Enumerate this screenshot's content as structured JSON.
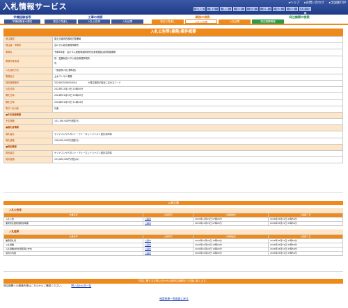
{
  "header": {
    "brand": "入札情報サービス",
    "links": [
      {
        "icon": "help-icon",
        "label": "ヘルプ"
      },
      {
        "icon": "mail-icon",
        "label": "お問い合わせ"
      },
      {
        "icon": "home-icon",
        "label": "全国版TOP"
      }
    ],
    "regions": [
      "北海道",
      "東北",
      "関東",
      "北陸",
      "中部",
      "近畿",
      "中国",
      "四国",
      "九州・沖縄"
    ]
  },
  "nav": {
    "groups": [
      {
        "title": "学識経験者等",
        "style": "blue",
        "tabs": [
          "学識経験者の選任"
        ]
      },
      {
        "title": "工事の検索",
        "style": "blue",
        "tabs": [
          "発注の見通し",
          "入札公告等",
          "入札結果"
        ]
      },
      {
        "title": "業務の検索",
        "style": "orange",
        "tabs": [
          "発注の見通し",
          "入札公告等",
          "入札結果"
        ],
        "selected": 1
      },
      {
        "title": "発注機関の検索",
        "style": "green",
        "tabs": [
          "発注機関情報"
        ]
      }
    ]
  },
  "page_title": "入札公告等(業務)案件概要",
  "info_rows": [
    {
      "key": "発注機関",
      "value": "国土交通省四国地方整備局"
    },
    {
      "key": "発注者・事務所",
      "value": "吉川ダム総合管理事務所"
    },
    {
      "key": "業務名",
      "value": "令和6年度　吉川ダム統管電源関係外自家発施設点検修繕業務"
    },
    {
      "key": "業務対象地域",
      "value": "県：愛媛県吉川ダム総合管理事務所",
      "value2": "市",
      "tall": true
    },
    {
      "key": "入札契約方式",
      "value": "一般競争入札(標準型)"
    },
    {
      "key": "業務区分",
      "value": "土木コンサル業務"
    },
    {
      "key": "契約管理番号",
      "value": "2024007006020004",
      "note": "※発注機関が独自に定めるコード"
    },
    {
      "key": "公告日時",
      "value": "2023年12月19日 10時00分"
    },
    {
      "key": "開札日時",
      "value": "2024年01月05日 10時00分"
    },
    {
      "key": "開札日時",
      "value": "2024年01月09日 11時44分"
    },
    {
      "key": "電子入札対象",
      "value": "対象"
    },
    {
      "key": "■予定価格情報",
      "section": true
    },
    {
      "key": "予定価格",
      "value": "141,190,000円(税抜き)"
    },
    {
      "key": "■落札者情報",
      "section": true
    },
    {
      "key": "落札者名",
      "value": "ケツナコンサルタント・ティーネットジャパン設計共同体"
    },
    {
      "key": "落札価格",
      "value": "136,000,000円(税抜き)"
    },
    {
      "key": "■契約情報",
      "section": true
    },
    {
      "key": "契約者名",
      "value": "ケツナコンサルタント・ティーネットジャパン設計共同体"
    },
    {
      "key": "契約金額",
      "value": "151,800,000円(税込み)"
    }
  ],
  "public_docs": {
    "title": "公開文書",
    "notice_head": "入札公告等",
    "results_head": "入札結果",
    "columns": [
      "文書名称",
      "公開状況",
      "公開開始日",
      "公開終了日"
    ],
    "notice_rows": [
      {
        "name": "入札公告",
        "status": "公開中",
        "start": "2023年12月19日 07時00分",
        "end": "2026年03月31日 23時59分"
      },
      {
        "name": "業務委託業務業務説明書",
        "status": "公開中",
        "start": "2023年12月19日 07時00分",
        "end": "2026年03月31日 23時59分"
      }
    ],
    "result_rows": [
      {
        "name": "業務落札者",
        "status": "公開中",
        "start": "2024年01月26日 10時00分",
        "end": "2026年03月31日 23時59分"
      },
      {
        "name": "入札調書",
        "status": "公開中",
        "start": "2024年01月26日 10時00分",
        "end": "2026年03月31日 23時59分"
      },
      {
        "name": "入札調書(総合評価落札方式)",
        "status": "公開中",
        "start": "2024年01月26日 10時00分",
        "end": "2026年03月31日 23時59分"
      },
      {
        "name": "契約の内容",
        "status": "公開中",
        "start": "2024年01月26日 14時00分",
        "end": "2026年03月31日 23時59分"
      }
    ]
  },
  "footer": {
    "band": "内容に関するお問い合わせは各発注機関までお願い致します。",
    "text": "発注機関への連絡先等はこちらからご確認ください。",
    "link": "問い合わせ先一覧",
    "back": "検索結果一覧画面に戻る"
  },
  "colors": {
    "accent": "#ee8a1b",
    "header": "#2b4a9c",
    "label_bg": "#fde5c8"
  }
}
